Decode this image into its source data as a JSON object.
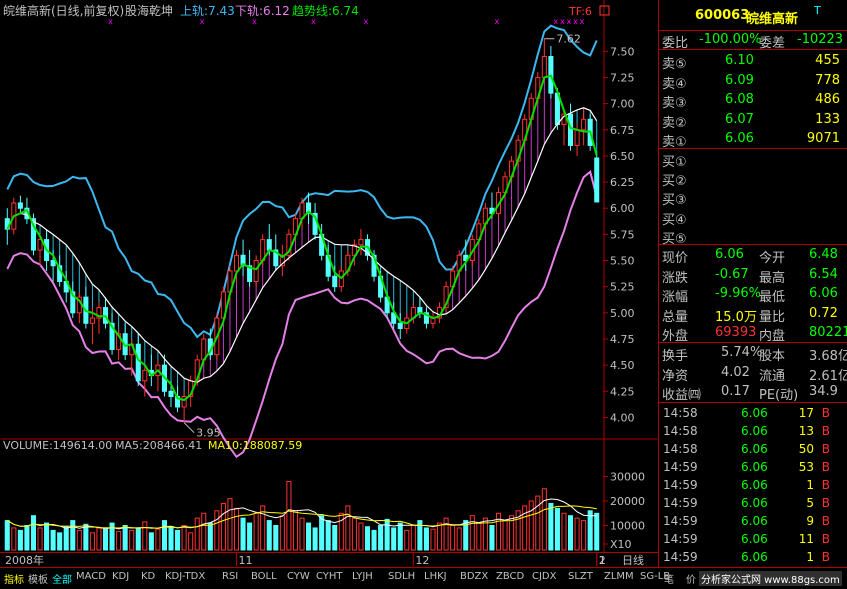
{
  "chart_header": {
    "stock_title": "皖维高新(日线,前复权)",
    "indicator_name": "股海乾坤",
    "upper_label": "上轨",
    "upper_value": ":7.43",
    "lower_label": "下轨",
    "lower_value": ":6.12",
    "trend_label": "趋势线",
    "trend_value": ":6.74",
    "tf_label": "TF:6"
  },
  "annotations": {
    "high": "7.62",
    "low": "3.95"
  },
  "volume_header": {
    "volume": "VOLUME:149614.00",
    "ma5": "MA5:208466.41",
    "ma10": "MA10:188087.59"
  },
  "x_labels": [
    "2008年",
    "11",
    "12",
    "1",
    "2"
  ],
  "period_label": "日线",
  "colors": {
    "up": "#ff3232",
    "down": "#54ffff",
    "band_upper": "#3cb8f0",
    "band_lower": "#e480e8",
    "trend": "#00e000",
    "white_line": "#ffffff",
    "yellow": "#ffff00",
    "magenta": "#ff00ff",
    "red_border": "#b00000"
  },
  "quote": {
    "code": "600063",
    "name": "皖维高新",
    "t_mark": "T",
    "ratio_label": "委比",
    "ratio_value": "-100.00%",
    "diff_label": "委差",
    "diff_value": "-10223",
    "asks": [
      {
        "label": "卖⑤",
        "price": "6.10",
        "vol": "455"
      },
      {
        "label": "卖④",
        "price": "6.09",
        "vol": "778"
      },
      {
        "label": "卖③",
        "price": "6.08",
        "vol": "486"
      },
      {
        "label": "卖②",
        "price": "6.07",
        "vol": "133"
      },
      {
        "label": "卖①",
        "price": "6.06",
        "vol": "9071"
      }
    ],
    "bids": [
      {
        "label": "买①"
      },
      {
        "label": "买②"
      },
      {
        "label": "买③"
      },
      {
        "label": "买④"
      },
      {
        "label": "买⑤"
      }
    ],
    "stats": [
      {
        "l1": "现价",
        "v1": "6.06",
        "c1": "#00ff00",
        "l2": "今开",
        "v2": "6.48",
        "c2": "#00ff00"
      },
      {
        "l1": "涨跌",
        "v1": "-0.67",
        "c1": "#00ff00",
        "l2": "最高",
        "v2": "6.54",
        "c2": "#00ff00"
      },
      {
        "l1": "涨幅",
        "v1": "-9.96%",
        "c1": "#00ff00",
        "l2": "最低",
        "v2": "6.06",
        "c2": "#00ff00"
      },
      {
        "l1": "总量",
        "v1": "15.0万",
        "c1": "#ffff00",
        "l2": "量比",
        "v2": "0.72",
        "c2": "#ffff00"
      },
      {
        "l1": "外盘",
        "v1": "69393",
        "c1": "#ff3232",
        "l2": "内盘",
        "v2": "80221",
        "c2": "#00ff00"
      }
    ],
    "fund": [
      {
        "l1": "换手",
        "v1": "5.74%",
        "l2": "股本",
        "v2": "3.68亿"
      },
      {
        "l1": "净资",
        "v1": "4.02",
        "l2": "流通",
        "v2": "2.61亿"
      },
      {
        "l1": "收益㈣",
        "v1": "0.17",
        "l2": "PE(动)",
        "v2": "34.9"
      }
    ],
    "ticks": [
      {
        "time": "14:58",
        "price": "6.06",
        "vol": "17",
        "side": "B"
      },
      {
        "time": "14:58",
        "price": "6.06",
        "vol": "13",
        "side": "B"
      },
      {
        "time": "14:58",
        "price": "6.06",
        "vol": "50",
        "side": "B"
      },
      {
        "time": "14:59",
        "price": "6.06",
        "vol": "53",
        "side": "B"
      },
      {
        "time": "14:59",
        "price": "6.06",
        "vol": "1",
        "side": "B"
      },
      {
        "time": "14:59",
        "price": "6.06",
        "vol": "5",
        "side": "B"
      },
      {
        "time": "14:59",
        "price": "6.06",
        "vol": "9",
        "side": "B"
      },
      {
        "time": "14:59",
        "price": "6.06",
        "vol": "11",
        "side": "B"
      },
      {
        "time": "14:59",
        "price": "6.06",
        "vol": "1",
        "side": "B"
      }
    ]
  },
  "bottom_tabs": [
    "指标",
    "模板",
    "全部",
    "MACD",
    "KDJ",
    "KD",
    "KDJ-TDX",
    "RSI",
    "BOLL",
    "CYW",
    "CYHT",
    "LYJH",
    "SDLH",
    "LHKJ",
    "BDZX",
    "ZBCD",
    "CJDX",
    "SLZT",
    "ZLMM",
    "SG-LB"
  ],
  "bottom_right": [
    "笔",
    "价",
    "分析家公式网 www.88gs.com"
  ],
  "chart_data": [
    {
      "type": "candlestick",
      "title": "皖维高新(日线,前复权)",
      "y_ticks": [
        "7.50",
        "7.25",
        "7.00",
        "6.75",
        "6.50",
        "6.25",
        "6.00",
        "5.75",
        "5.50",
        "5.25",
        "5.00",
        "4.75",
        "4.50",
        "4.25",
        "4.00"
      ],
      "ylim": [
        3.88,
        7.78
      ],
      "candles": [
        [
          5.9,
          6.0,
          5.65,
          5.8
        ],
        [
          5.8,
          6.1,
          5.75,
          6.05
        ],
        [
          6.05,
          6.12,
          5.95,
          6.0
        ],
        [
          6.0,
          6.1,
          5.85,
          5.9
        ],
        [
          5.9,
          5.95,
          5.55,
          5.6
        ],
        [
          5.6,
          5.75,
          5.45,
          5.7
        ],
        [
          5.7,
          5.8,
          5.4,
          5.5
        ],
        [
          5.5,
          5.6,
          5.3,
          5.45
        ],
        [
          5.45,
          5.55,
          5.25,
          5.3
        ],
        [
          5.3,
          5.4,
          5.1,
          5.2
        ],
        [
          5.2,
          5.3,
          4.95,
          5.0
        ],
        [
          5.0,
          5.2,
          4.9,
          5.15
        ],
        [
          5.15,
          5.25,
          4.85,
          4.9
        ],
        [
          4.9,
          5.05,
          4.7,
          4.95
        ],
        [
          4.95,
          5.1,
          4.8,
          5.05
        ],
        [
          5.05,
          5.15,
          4.85,
          4.9
        ],
        [
          4.9,
          5.0,
          4.6,
          4.65
        ],
        [
          4.65,
          4.85,
          4.55,
          4.8
        ],
        [
          4.8,
          4.9,
          4.55,
          4.6
        ],
        [
          4.6,
          4.75,
          4.4,
          4.7
        ],
        [
          4.7,
          4.8,
          4.3,
          4.35
        ],
        [
          4.35,
          4.5,
          4.2,
          4.45
        ],
        [
          4.45,
          4.6,
          4.3,
          4.4
        ],
        [
          4.4,
          4.55,
          4.25,
          4.5
        ],
        [
          4.5,
          4.6,
          4.2,
          4.25
        ],
        [
          4.25,
          4.35,
          4.1,
          4.2
        ],
        [
          4.2,
          4.3,
          4.05,
          4.1
        ],
        [
          4.1,
          4.25,
          3.95,
          4.2
        ],
        [
          4.2,
          4.4,
          4.1,
          4.35
        ],
        [
          4.35,
          4.6,
          4.3,
          4.55
        ],
        [
          4.55,
          4.8,
          4.5,
          4.75
        ],
        [
          4.75,
          4.85,
          4.55,
          4.6
        ],
        [
          4.6,
          5.0,
          4.55,
          4.95
        ],
        [
          4.95,
          5.25,
          4.9,
          5.2
        ],
        [
          5.2,
          5.45,
          5.1,
          5.4
        ],
        [
          5.4,
          5.6,
          5.3,
          5.55
        ],
        [
          5.55,
          5.7,
          5.35,
          5.45
        ],
        [
          5.45,
          5.6,
          5.25,
          5.3
        ],
        [
          5.3,
          5.55,
          5.25,
          5.5
        ],
        [
          5.5,
          5.75,
          5.45,
          5.7
        ],
        [
          5.7,
          5.85,
          5.55,
          5.6
        ],
        [
          5.6,
          5.75,
          5.4,
          5.45
        ],
        [
          5.45,
          5.65,
          5.35,
          5.55
        ],
        [
          5.55,
          5.8,
          5.5,
          5.75
        ],
        [
          5.75,
          5.95,
          5.7,
          5.9
        ],
        [
          5.9,
          6.1,
          5.8,
          6.05
        ],
        [
          6.05,
          6.15,
          5.85,
          5.95
        ],
        [
          5.95,
          6.05,
          5.7,
          5.75
        ],
        [
          5.75,
          5.85,
          5.5,
          5.55
        ],
        [
          5.55,
          5.65,
          5.3,
          5.35
        ],
        [
          5.35,
          5.45,
          5.2,
          5.25
        ],
        [
          5.25,
          5.45,
          5.2,
          5.4
        ],
        [
          5.4,
          5.6,
          5.35,
          5.55
        ],
        [
          5.55,
          5.7,
          5.45,
          5.65
        ],
        [
          5.65,
          5.8,
          5.55,
          5.7
        ],
        [
          5.7,
          5.75,
          5.5,
          5.55
        ],
        [
          5.55,
          5.6,
          5.3,
          5.35
        ],
        [
          5.35,
          5.4,
          5.1,
          5.15
        ],
        [
          5.15,
          5.2,
          4.95,
          5.0
        ],
        [
          5.0,
          5.1,
          4.85,
          4.9
        ],
        [
          4.9,
          5.0,
          4.75,
          4.85
        ],
        [
          4.85,
          5.0,
          4.8,
          4.95
        ],
        [
          4.95,
          5.1,
          4.9,
          5.05
        ],
        [
          5.05,
          5.15,
          4.95,
          5.0
        ],
        [
          5.0,
          5.05,
          4.85,
          4.9
        ],
        [
          4.9,
          5.0,
          4.85,
          4.95
        ],
        [
          4.95,
          5.1,
          4.9,
          5.05
        ],
        [
          5.05,
          5.3,
          5.0,
          5.25
        ],
        [
          5.25,
          5.45,
          5.2,
          5.4
        ],
        [
          5.4,
          5.6,
          5.35,
          5.55
        ],
        [
          5.55,
          5.7,
          5.4,
          5.5
        ],
        [
          5.5,
          5.75,
          5.45,
          5.7
        ],
        [
          5.7,
          5.9,
          5.65,
          5.85
        ],
        [
          5.85,
          6.05,
          5.8,
          6.0
        ],
        [
          6.0,
          6.15,
          5.9,
          5.95
        ],
        [
          5.95,
          6.2,
          5.9,
          6.15
        ],
        [
          6.15,
          6.35,
          6.1,
          6.3
        ],
        [
          6.3,
          6.5,
          6.25,
          6.45
        ],
        [
          6.45,
          6.7,
          6.4,
          6.65
        ],
        [
          6.65,
          6.9,
          6.6,
          6.85
        ],
        [
          6.85,
          7.1,
          6.8,
          7.05
        ],
        [
          7.05,
          7.3,
          7.0,
          7.25
        ],
        [
          7.25,
          7.62,
          7.2,
          7.45
        ],
        [
          7.45,
          7.55,
          7.05,
          7.1
        ],
        [
          7.1,
          7.15,
          6.75,
          6.8
        ],
        [
          6.8,
          6.95,
          6.6,
          6.9
        ],
        [
          6.9,
          7.0,
          6.55,
          6.6
        ],
        [
          6.6,
          6.8,
          6.5,
          6.75
        ],
        [
          6.75,
          6.95,
          6.6,
          6.85
        ],
        [
          6.85,
          6.9,
          6.55,
          6.6
        ],
        [
          6.48,
          6.54,
          6.06,
          6.06
        ]
      ]
    },
    {
      "type": "bar",
      "title": "VOLUME",
      "y_ticks": [
        "30000",
        "20000",
        "10000",
        "X10"
      ],
      "ylim": [
        0,
        40000
      ],
      "values": [
        12000,
        9000,
        8000,
        10000,
        14000,
        9000,
        11000,
        8000,
        7000,
        9500,
        12000,
        8000,
        10500,
        7000,
        9000,
        8500,
        11000,
        7500,
        10000,
        8000,
        9000,
        11500,
        7000,
        8500,
        12000,
        9500,
        8000,
        10000,
        7000,
        13000,
        15000,
        11000,
        16000,
        19000,
        21000,
        17000,
        13000,
        11000,
        15000,
        18000,
        12000,
        10000,
        14000,
        28000,
        16000,
        13000,
        11000,
        9000,
        14000,
        12000,
        10000,
        15000,
        18000,
        13000,
        11000,
        9500,
        8000,
        10000,
        12500,
        9000,
        11000,
        8000,
        10000,
        12000,
        9000,
        8500,
        11000,
        13000,
        10000,
        9000,
        12000,
        14000,
        11000,
        13000,
        10000,
        15000,
        12000,
        14000,
        16000,
        18000,
        20000,
        22000,
        25000,
        19000,
        17000,
        15000,
        14000,
        13000,
        12000,
        16000,
        14961
      ],
      "lines": {
        "MA5": "yellow",
        "MA10": "white"
      }
    }
  ]
}
